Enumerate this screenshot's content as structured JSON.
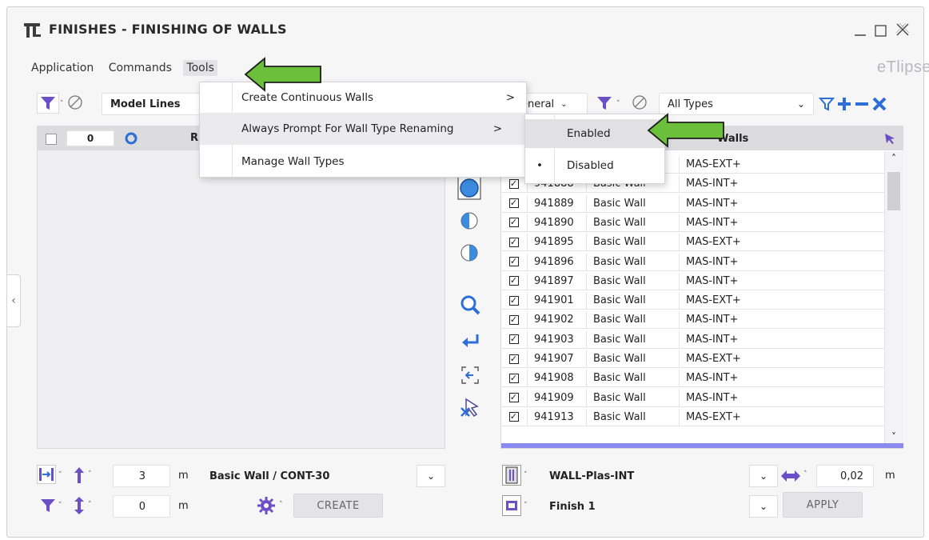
{
  "window": {
    "title": "FINISHES - FINISHING OF WALLS",
    "brand": "eTlipse",
    "colors": {
      "accent": "#3b8be0",
      "filter_purple": "#6a4fc7",
      "arrow_green": "#6cbf3a",
      "selected_bar": "#8a8af0"
    }
  },
  "menubar": {
    "items": [
      "Application",
      "Commands",
      "Tools"
    ]
  },
  "tools_menu": {
    "items": [
      {
        "label": "Create Continuous Walls",
        "arrow": ">"
      },
      {
        "label": "Always Prompt For Wall Type Renaming",
        "arrow": ">"
      },
      {
        "label": "Manage Wall Types",
        "arrow": ""
      }
    ]
  },
  "submenu": {
    "items": [
      {
        "label": "Enabled",
        "bullet": ""
      },
      {
        "label": "Disabled",
        "bullet": "•"
      }
    ]
  },
  "left_panel": {
    "category_value": "Model Lines",
    "count": "0",
    "header_partial": "R"
  },
  "right_panel": {
    "group_value": "eneral",
    "type_value": "All Types",
    "header_type": "Walls",
    "rows": [
      {
        "id": "",
        "family": "",
        "type": "MAS-EXT+"
      },
      {
        "id": "941888",
        "family": "Basic Wall",
        "type": "MAS-INT+"
      },
      {
        "id": "941889",
        "family": "Basic Wall",
        "type": "MAS-INT+"
      },
      {
        "id": "941890",
        "family": "Basic Wall",
        "type": "MAS-INT+"
      },
      {
        "id": "941895",
        "family": "Basic Wall",
        "type": "MAS-EXT+"
      },
      {
        "id": "941896",
        "family": "Basic Wall",
        "type": "MAS-INT+"
      },
      {
        "id": "941897",
        "family": "Basic Wall",
        "type": "MAS-INT+"
      },
      {
        "id": "941901",
        "family": "Basic Wall",
        "type": "MAS-EXT+"
      },
      {
        "id": "941902",
        "family": "Basic Wall",
        "type": "MAS-INT+"
      },
      {
        "id": "941903",
        "family": "Basic Wall",
        "type": "MAS-INT+"
      },
      {
        "id": "941907",
        "family": "Basic Wall",
        "type": "MAS-EXT+"
      },
      {
        "id": "941908",
        "family": "Basic Wall",
        "type": "MAS-INT+"
      },
      {
        "id": "941909",
        "family": "Basic Wall",
        "type": "MAS-INT+"
      },
      {
        "id": "941913",
        "family": "Basic Wall",
        "type": "MAS-EXT+"
      }
    ]
  },
  "bottom_left": {
    "height_value": "3",
    "height_unit": "m",
    "wall_type": "Basic Wall / CONT-30",
    "offset_value": "0",
    "offset_unit": "m",
    "create_label": "CREATE"
  },
  "bottom_right": {
    "finish_type": "WALL-Plas-INT",
    "thickness_value": "0,02",
    "thickness_unit": "m",
    "finish_name": "Finish 1",
    "apply_label": "APPLY"
  }
}
